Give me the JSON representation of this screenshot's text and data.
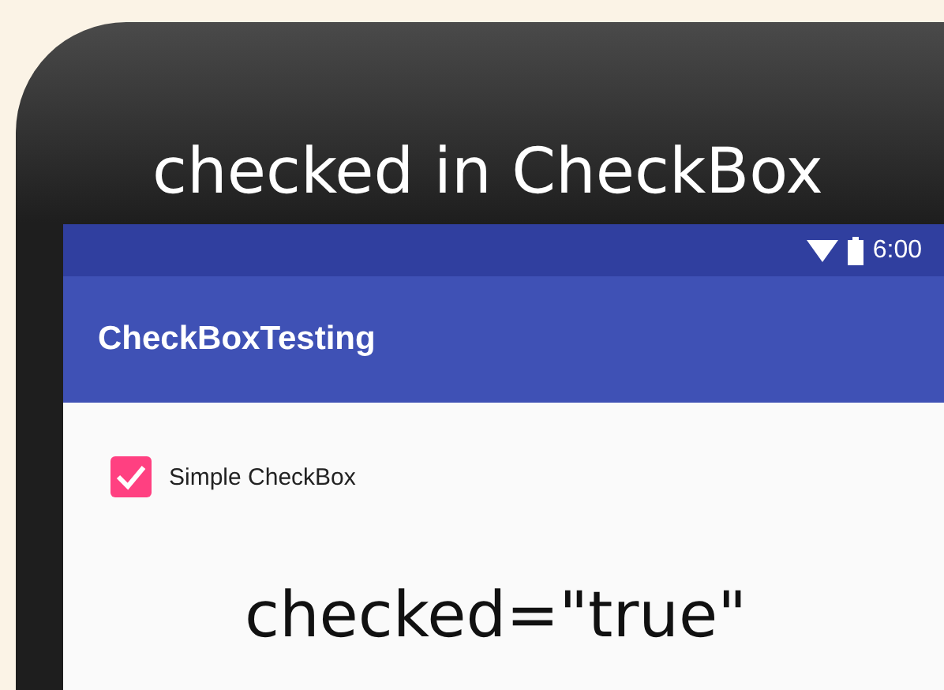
{
  "overlay_title": "checked in CheckBox",
  "status_bar": {
    "time": "6:00"
  },
  "app_bar": {
    "title": "CheckBoxTesting"
  },
  "checkbox": {
    "label": "Simple CheckBox",
    "checked": true
  },
  "caption": "checked=\"true\""
}
